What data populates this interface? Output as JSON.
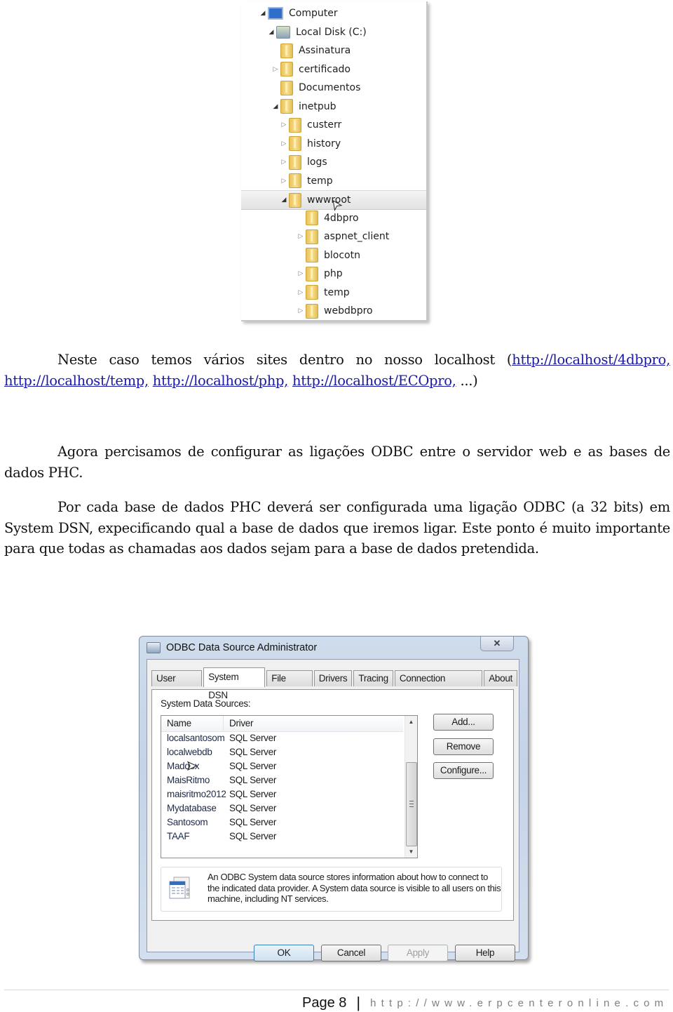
{
  "explorer_tree": {
    "items": [
      {
        "label": "Computer",
        "icon": "computer-icon",
        "level": 0,
        "expander": "expanded",
        "selected": false
      },
      {
        "label": "Local Disk (C:)",
        "icon": "local-disk-icon",
        "level": 1,
        "expander": "expanded",
        "selected": false
      },
      {
        "label": "Assinatura",
        "icon": "folder-icon",
        "level": 2,
        "expander": "none",
        "selected": false
      },
      {
        "label": "certificado",
        "icon": "folder-icon",
        "level": 2,
        "expander": "collapsed",
        "selected": false
      },
      {
        "label": "Documentos",
        "icon": "folder-icon",
        "level": 2,
        "expander": "none",
        "selected": false
      },
      {
        "label": "inetpub",
        "icon": "folder-icon",
        "level": 2,
        "expander": "expanded",
        "selected": false
      },
      {
        "label": "custerr",
        "icon": "folder-icon",
        "level": 3,
        "expander": "collapsed",
        "selected": false
      },
      {
        "label": "history",
        "icon": "folder-icon",
        "level": 3,
        "expander": "collapsed",
        "selected": false
      },
      {
        "label": "logs",
        "icon": "folder-icon",
        "level": 3,
        "expander": "collapsed",
        "selected": false
      },
      {
        "label": "temp",
        "icon": "folder-icon",
        "level": 3,
        "expander": "collapsed",
        "selected": false
      },
      {
        "label": "wwwroot",
        "icon": "folder-icon",
        "level": 3,
        "expander": "expanded",
        "selected": true
      },
      {
        "label": "4dbpro",
        "icon": "folder-icon",
        "level": 4,
        "expander": "none",
        "selected": false
      },
      {
        "label": "aspnet_client",
        "icon": "folder-icon",
        "level": 4,
        "expander": "collapsed",
        "selected": false
      },
      {
        "label": "blocotn",
        "icon": "folder-icon",
        "level": 4,
        "expander": "none",
        "selected": false
      },
      {
        "label": "php",
        "icon": "folder-icon",
        "level": 4,
        "expander": "collapsed",
        "selected": false
      },
      {
        "label": "temp",
        "icon": "folder-icon",
        "level": 4,
        "expander": "collapsed",
        "selected": false
      },
      {
        "label": "webdbpro",
        "icon": "folder-icon",
        "level": 4,
        "expander": "collapsed",
        "selected": false
      }
    ]
  },
  "paragraphs": {
    "p1": {
      "text_before": "Neste caso temos vários sites dentro no nosso localhost (",
      "links": [
        "http://localhost/4dbpro,",
        "http://localhost/temp,",
        "http://localhost/php,",
        "http://localhost/ECOpro,"
      ],
      "text_after": " ...)"
    },
    "p2": "Agora percisamos de configurar as ligações ODBC entre o servidor web e as bases de dados PHC.",
    "p3": "Por cada base de dados PHC deverá ser configurada uma ligação ODBC (a 32 bits) em System DSN, expecificando qual a base de dados que iremos ligar. Este ponto é muito importante para que todas as chamadas aos dados sejam para a base de dados pretendida."
  },
  "odbc_dialog": {
    "title": "ODBC Data Source Administrator",
    "close_glyph": "✕",
    "tabs": [
      {
        "label": "User DSN",
        "active": false
      },
      {
        "label": "System DSN",
        "active": true
      },
      {
        "label": "File DSN",
        "active": false
      },
      {
        "label": "Drivers",
        "active": false
      },
      {
        "label": "Tracing",
        "active": false
      },
      {
        "label": "Connection Pooling",
        "active": false
      },
      {
        "label": "About",
        "active": false
      }
    ],
    "panel_label": "System Data Sources:",
    "columns": [
      "Name",
      "Driver"
    ],
    "rows": [
      {
        "name": "localsantosom",
        "driver": "SQL Server"
      },
      {
        "name": "localwebdb",
        "driver": "SQL Server"
      },
      {
        "name": "Maddox",
        "driver": "SQL Server"
      },
      {
        "name": "MaisRitmo",
        "driver": "SQL Server"
      },
      {
        "name": "maisritmo2012",
        "driver": "SQL Server"
      },
      {
        "name": "Mydatabase",
        "driver": "SQL Server"
      },
      {
        "name": "Santosom",
        "driver": "SQL Server"
      },
      {
        "name": "TAAF",
        "driver": "SQL Server"
      }
    ],
    "side_buttons": {
      "add": "Add...",
      "remove": "Remove",
      "configure": "Configure..."
    },
    "info_text": "An ODBC System data source stores information about how to connect to the indicated data provider.   A System data source is visible to all users on this machine, including NT services.",
    "bottom_buttons": {
      "ok": "OK",
      "cancel": "Cancel",
      "apply": "Apply",
      "help": "Help"
    },
    "scroll_arrows": {
      "up": "▲",
      "down": "▼"
    }
  },
  "footer": {
    "page_label": "Page 8",
    "separator": "|",
    "url": "http://www.erpcenteronline.com"
  },
  "colors": {
    "link": "#1a1aa6",
    "footer_url": "#7f7f7f"
  }
}
